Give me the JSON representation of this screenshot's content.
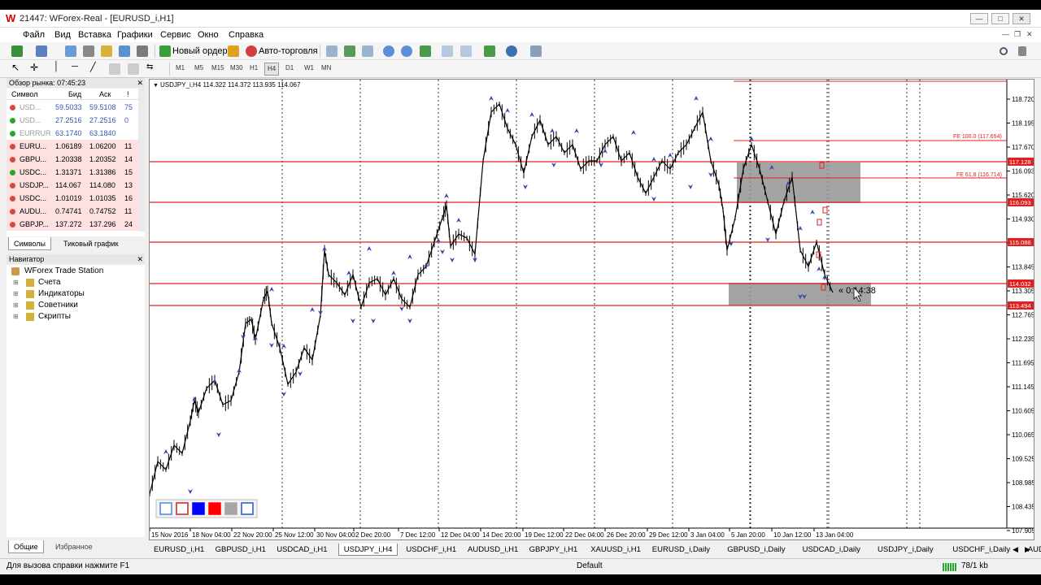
{
  "window": {
    "title": "21447: WForex-Real - [EURUSD_i,H1]"
  },
  "menu": [
    "Файл",
    "Вид",
    "Вставка",
    "Графики",
    "Сервис",
    "Окно",
    "Справка"
  ],
  "toolbar": {
    "new_order": "Новый ордер",
    "autotrading": "Авто-торговля"
  },
  "timeframes": [
    "M1",
    "M5",
    "M15",
    "M30",
    "H1",
    "H4",
    "D1",
    "W1",
    "MN"
  ],
  "active_timeframe": "H4",
  "market_watch": {
    "title": "Обзор рынка: 07:45:23",
    "headers": [
      "Символ",
      "Бид",
      "Аск",
      "!"
    ],
    "rows": [
      {
        "symbol": "USD...",
        "bid": "59.5033",
        "ask": "59.5108",
        "spread": "75",
        "color": "#d44",
        "gray": true
      },
      {
        "symbol": "USD...",
        "bid": "27.2516",
        "ask": "27.2516",
        "spread": "0",
        "color": "#2a2",
        "gray": true
      },
      {
        "symbol": "EURRUR",
        "bid": "63.1740",
        "ask": "63.1840",
        "spread": "",
        "color": "#2a2",
        "gray": true
      },
      {
        "symbol": "EURU...",
        "bid": "1.06189",
        "ask": "1.06200",
        "spread": "11",
        "color": "#d44",
        "gray": false
      },
      {
        "symbol": "GBPU...",
        "bid": "1.20338",
        "ask": "1.20352",
        "spread": "14",
        "color": "#d44",
        "gray": false
      },
      {
        "symbol": "USDC...",
        "bid": "1.31371",
        "ask": "1.31386",
        "spread": "15",
        "color": "#2a2",
        "gray": false
      },
      {
        "symbol": "USDJP...",
        "bid": "114.067",
        "ask": "114.080",
        "spread": "13",
        "color": "#d44",
        "gray": false
      },
      {
        "symbol": "USDC...",
        "bid": "1.01019",
        "ask": "1.01035",
        "spread": "16",
        "color": "#d44",
        "gray": false
      },
      {
        "symbol": "AUDU...",
        "bid": "0.74741",
        "ask": "0.74752",
        "spread": "11",
        "color": "#d44",
        "gray": false
      },
      {
        "symbol": "GBPJP...",
        "bid": "137.272",
        "ask": "137.296",
        "spread": "24",
        "color": "#d44",
        "gray": false
      }
    ],
    "tabs": [
      "Символы",
      "Тиковый график"
    ]
  },
  "navigator": {
    "title": "Навигатор",
    "root": "WForex Trade Station",
    "items": [
      "Счета",
      "Индикаторы",
      "Советники",
      "Скрипты"
    ],
    "tabs": [
      "Общие",
      "Избранное"
    ]
  },
  "chart": {
    "header": "USDJPY_i,H4  114.322 114.372 113.935 114.067",
    "price_axis": [
      "118.720",
      "118.195",
      "117.670",
      "116.093",
      "115.620",
      "114.930",
      "114.400",
      "113.845",
      "113.305",
      "112.765",
      "112.235",
      "111.695",
      "111.145",
      "110.605",
      "110.065",
      "109.525",
      "108.985",
      "108.435",
      "107.905"
    ],
    "price_labels": [
      {
        "value": "117.128",
        "color": "#e02020"
      },
      {
        "value": "116.093",
        "color": "#e02020"
      },
      {
        "value": "115.088",
        "color": "#e02020"
      },
      {
        "value": "114.032",
        "color": "#e02020"
      },
      {
        "value": "113.494",
        "color": "#e02020"
      }
    ],
    "fib_labels": [
      "FE 100.0  (117.654)",
      "FE 61.8  (116.714)"
    ],
    "countdown": "« 0:14:38",
    "time_axis": [
      "15 Nov 2016",
      "18 Nov 04:00",
      "22 Nov 20:00",
      "25 Nov 12:00",
      "30 Nov 04:00",
      "2 Dec 20:00",
      "7 Dec 12:00",
      "12 Dec 04:00",
      "14 Dec 20:00",
      "19 Dec 12:00",
      "22 Dec 04:00",
      "26 Dec 20:00",
      "29 Dec 12:00",
      "3 Jan 04:00",
      "5 Jan 20:00",
      "10 Jan 12:00",
      "13 Jan 04:00"
    ]
  },
  "chart_tabs": [
    "EURUSD_i,H1",
    "GBPUSD_i,H1",
    "USDCAD_i,H1",
    "USDJPY_i,H4",
    "USDCHF_i,H1",
    "AUDUSD_i,H1",
    "GBPJPY_i,H1",
    "XAUUSD_i,H1",
    "EURUSD_i,Daily",
    "GBPUSD_i,Daily",
    "USDCAD_i,Daily",
    "USDJPY_i,Daily",
    "USDCHF_i,Daily",
    "AUDUSD_i,D"
  ],
  "active_chart_tab": "USDJPY_i,H4",
  "status": {
    "help": "Для вызова справки нажмите F1",
    "profile": "Default",
    "traffic": "78/1 kb"
  }
}
